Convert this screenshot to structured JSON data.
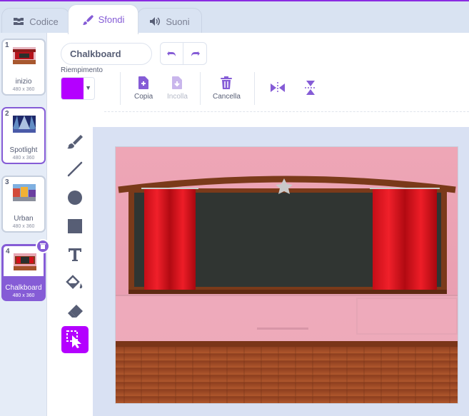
{
  "tabs": {
    "code": "Codice",
    "backdrops": "Sfondi",
    "sounds": "Suoni"
  },
  "costumes": [
    {
      "num": "1",
      "name": "inizio",
      "size": "480 x 360"
    },
    {
      "num": "2",
      "name": "Spotlight",
      "size": "480 x 360"
    },
    {
      "num": "3",
      "name": "Urban",
      "size": "480 x 360"
    },
    {
      "num": "4",
      "name": "Chalkboard",
      "size": "480 x 360"
    }
  ],
  "editor": {
    "costume_name": "Chalkboard",
    "fill_label": "Riempimento",
    "fill_color": "#b400ff",
    "copy_label": "Copia",
    "paste_label": "Incolla",
    "delete_label": "Cancella"
  },
  "colors": {
    "accent": "#855cd6",
    "tool_active": "#b400ff"
  }
}
